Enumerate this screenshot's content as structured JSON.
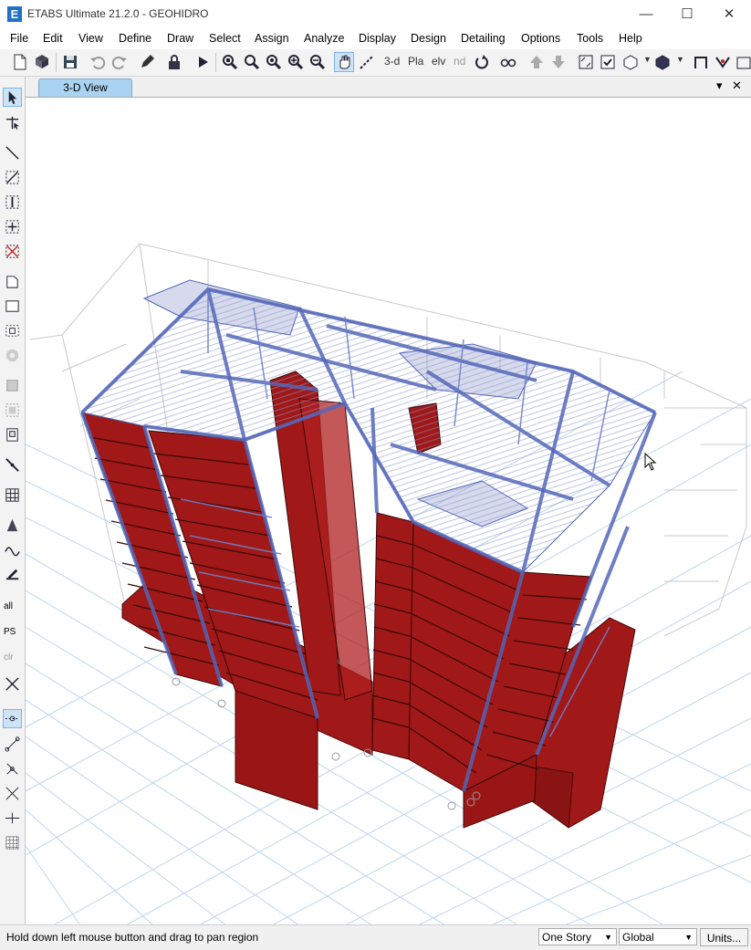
{
  "window": {
    "title": "ETABS Ultimate 21.2.0 - GEOHIDRO",
    "logo_letter": "E",
    "minimize": "—",
    "maximize": "☐",
    "close": "✕"
  },
  "menu": [
    "File",
    "Edit",
    "View",
    "Define",
    "Draw",
    "Select",
    "Assign",
    "Analyze",
    "Display",
    "Design",
    "Detailing",
    "Options",
    "Tools",
    "Help"
  ],
  "toolbar": {
    "text_3d": "3-d",
    "text_pla": "Pla",
    "text_elv": "elv",
    "text_nd": "nd"
  },
  "left_toolbar": {
    "all": "all",
    "ps": "PS",
    "clr": "clr"
  },
  "tab": {
    "label": "3-D View",
    "dropdown": "▾",
    "close": "✕"
  },
  "status": {
    "message": "Hold down left mouse button and drag to pan region",
    "story_combo": "One Story",
    "coord_combo": "Global",
    "units_button": "Units..."
  },
  "colors": {
    "wall": "#a01818",
    "frame": "#5567b8",
    "grid": "#bcd6ef",
    "tab": "#aad3f2"
  }
}
